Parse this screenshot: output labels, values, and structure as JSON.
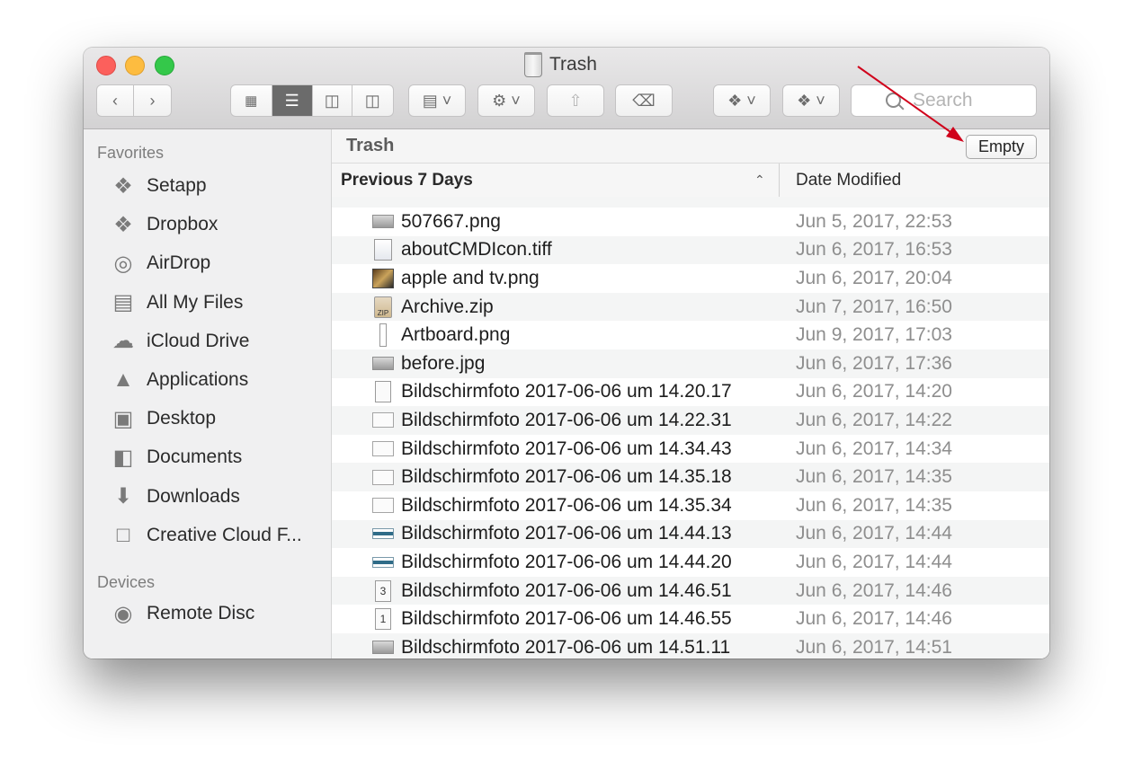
{
  "window": {
    "title": "Trash",
    "title_icon": "trash-can-icon"
  },
  "toolbar": {
    "back_icon": "chevron-left-icon",
    "forward_icon": "chevron-right-icon",
    "view_modes": [
      "icon-view-icon",
      "list-view-icon",
      "column-view-icon",
      "cover-flow-icon"
    ],
    "active_view": "list-view-icon",
    "group_icon": "group-by-icon",
    "action_icon": "gear-icon",
    "share_icon": "share-icon",
    "tag_icon": "tag-icon",
    "dropbox_icon": "dropbox-icon",
    "setapp_icon": "setapp-icon",
    "search_placeholder": "Search"
  },
  "sidebar": {
    "favorites_label": "Favorites",
    "favorites": [
      {
        "label": "Setapp",
        "icon": "setapp-icon"
      },
      {
        "label": "Dropbox",
        "icon": "dropbox-icon"
      },
      {
        "label": "AirDrop",
        "icon": "airdrop-icon"
      },
      {
        "label": "All My Files",
        "icon": "all-files-icon"
      },
      {
        "label": "iCloud Drive",
        "icon": "cloud-icon"
      },
      {
        "label": "Applications",
        "icon": "applications-icon"
      },
      {
        "label": "Desktop",
        "icon": "desktop-icon"
      },
      {
        "label": "Documents",
        "icon": "documents-icon"
      },
      {
        "label": "Downloads",
        "icon": "download-icon"
      },
      {
        "label": "Creative Cloud F...",
        "icon": "folder-icon"
      }
    ],
    "devices_label": "Devices",
    "devices": [
      {
        "label": "Remote Disc",
        "icon": "disc-icon"
      }
    ]
  },
  "pathbar": {
    "location": "Trash",
    "empty_button": "Empty"
  },
  "columns": {
    "group": "Previous 7 Days",
    "date": "Date Modified"
  },
  "files": [
    {
      "name": "507667.png",
      "date": "Jun 5, 2017, 22:53",
      "icon": "image"
    },
    {
      "name": "aboutCMDIcon.tiff",
      "date": "Jun 6, 2017, 16:53",
      "icon": "tiff"
    },
    {
      "name": "apple and tv.png",
      "date": "Jun 6, 2017, 20:04",
      "icon": "photo"
    },
    {
      "name": "Archive.zip",
      "date": "Jun 7, 2017, 16:50",
      "icon": "zip"
    },
    {
      "name": "Artboard.png",
      "date": "Jun 9, 2017, 17:03",
      "icon": "thin"
    },
    {
      "name": "before.jpg",
      "date": "Jun 6, 2017, 17:36",
      "icon": "image"
    },
    {
      "name": "Bildschirmfoto 2017-06-06 um 14.20.17",
      "date": "Jun 6, 2017, 14:20",
      "icon": "doc"
    },
    {
      "name": "Bildschirmfoto 2017-06-06 um 14.22.31",
      "date": "Jun 6, 2017, 14:22",
      "icon": "shot"
    },
    {
      "name": "Bildschirmfoto 2017-06-06 um 14.34.43",
      "date": "Jun 6, 2017, 14:34",
      "icon": "shot"
    },
    {
      "name": "Bildschirmfoto 2017-06-06 um 14.35.18",
      "date": "Jun 6, 2017, 14:35",
      "icon": "shot"
    },
    {
      "name": "Bildschirmfoto 2017-06-06 um 14.35.34",
      "date": "Jun 6, 2017, 14:35",
      "icon": "shot"
    },
    {
      "name": "Bildschirmfoto 2017-06-06 um 14.44.13",
      "date": "Jun 6, 2017, 14:44",
      "icon": "blue"
    },
    {
      "name": "Bildschirmfoto 2017-06-06 um 14.44.20",
      "date": "Jun 6, 2017, 14:44",
      "icon": "blue"
    },
    {
      "name": "Bildschirmfoto 2017-06-06 um 14.46.51",
      "date": "Jun 6, 2017, 14:46",
      "icon": "doc",
      "glyph": "3"
    },
    {
      "name": "Bildschirmfoto 2017-06-06 um 14.46.55",
      "date": "Jun 6, 2017, 14:46",
      "icon": "doc",
      "glyph": "1"
    },
    {
      "name": "Bildschirmfoto 2017-06-06 um 14.51.11",
      "date": "Jun 6, 2017, 14:51",
      "icon": "image"
    }
  ],
  "annotation": {
    "arrow_color": "#d0021b"
  }
}
